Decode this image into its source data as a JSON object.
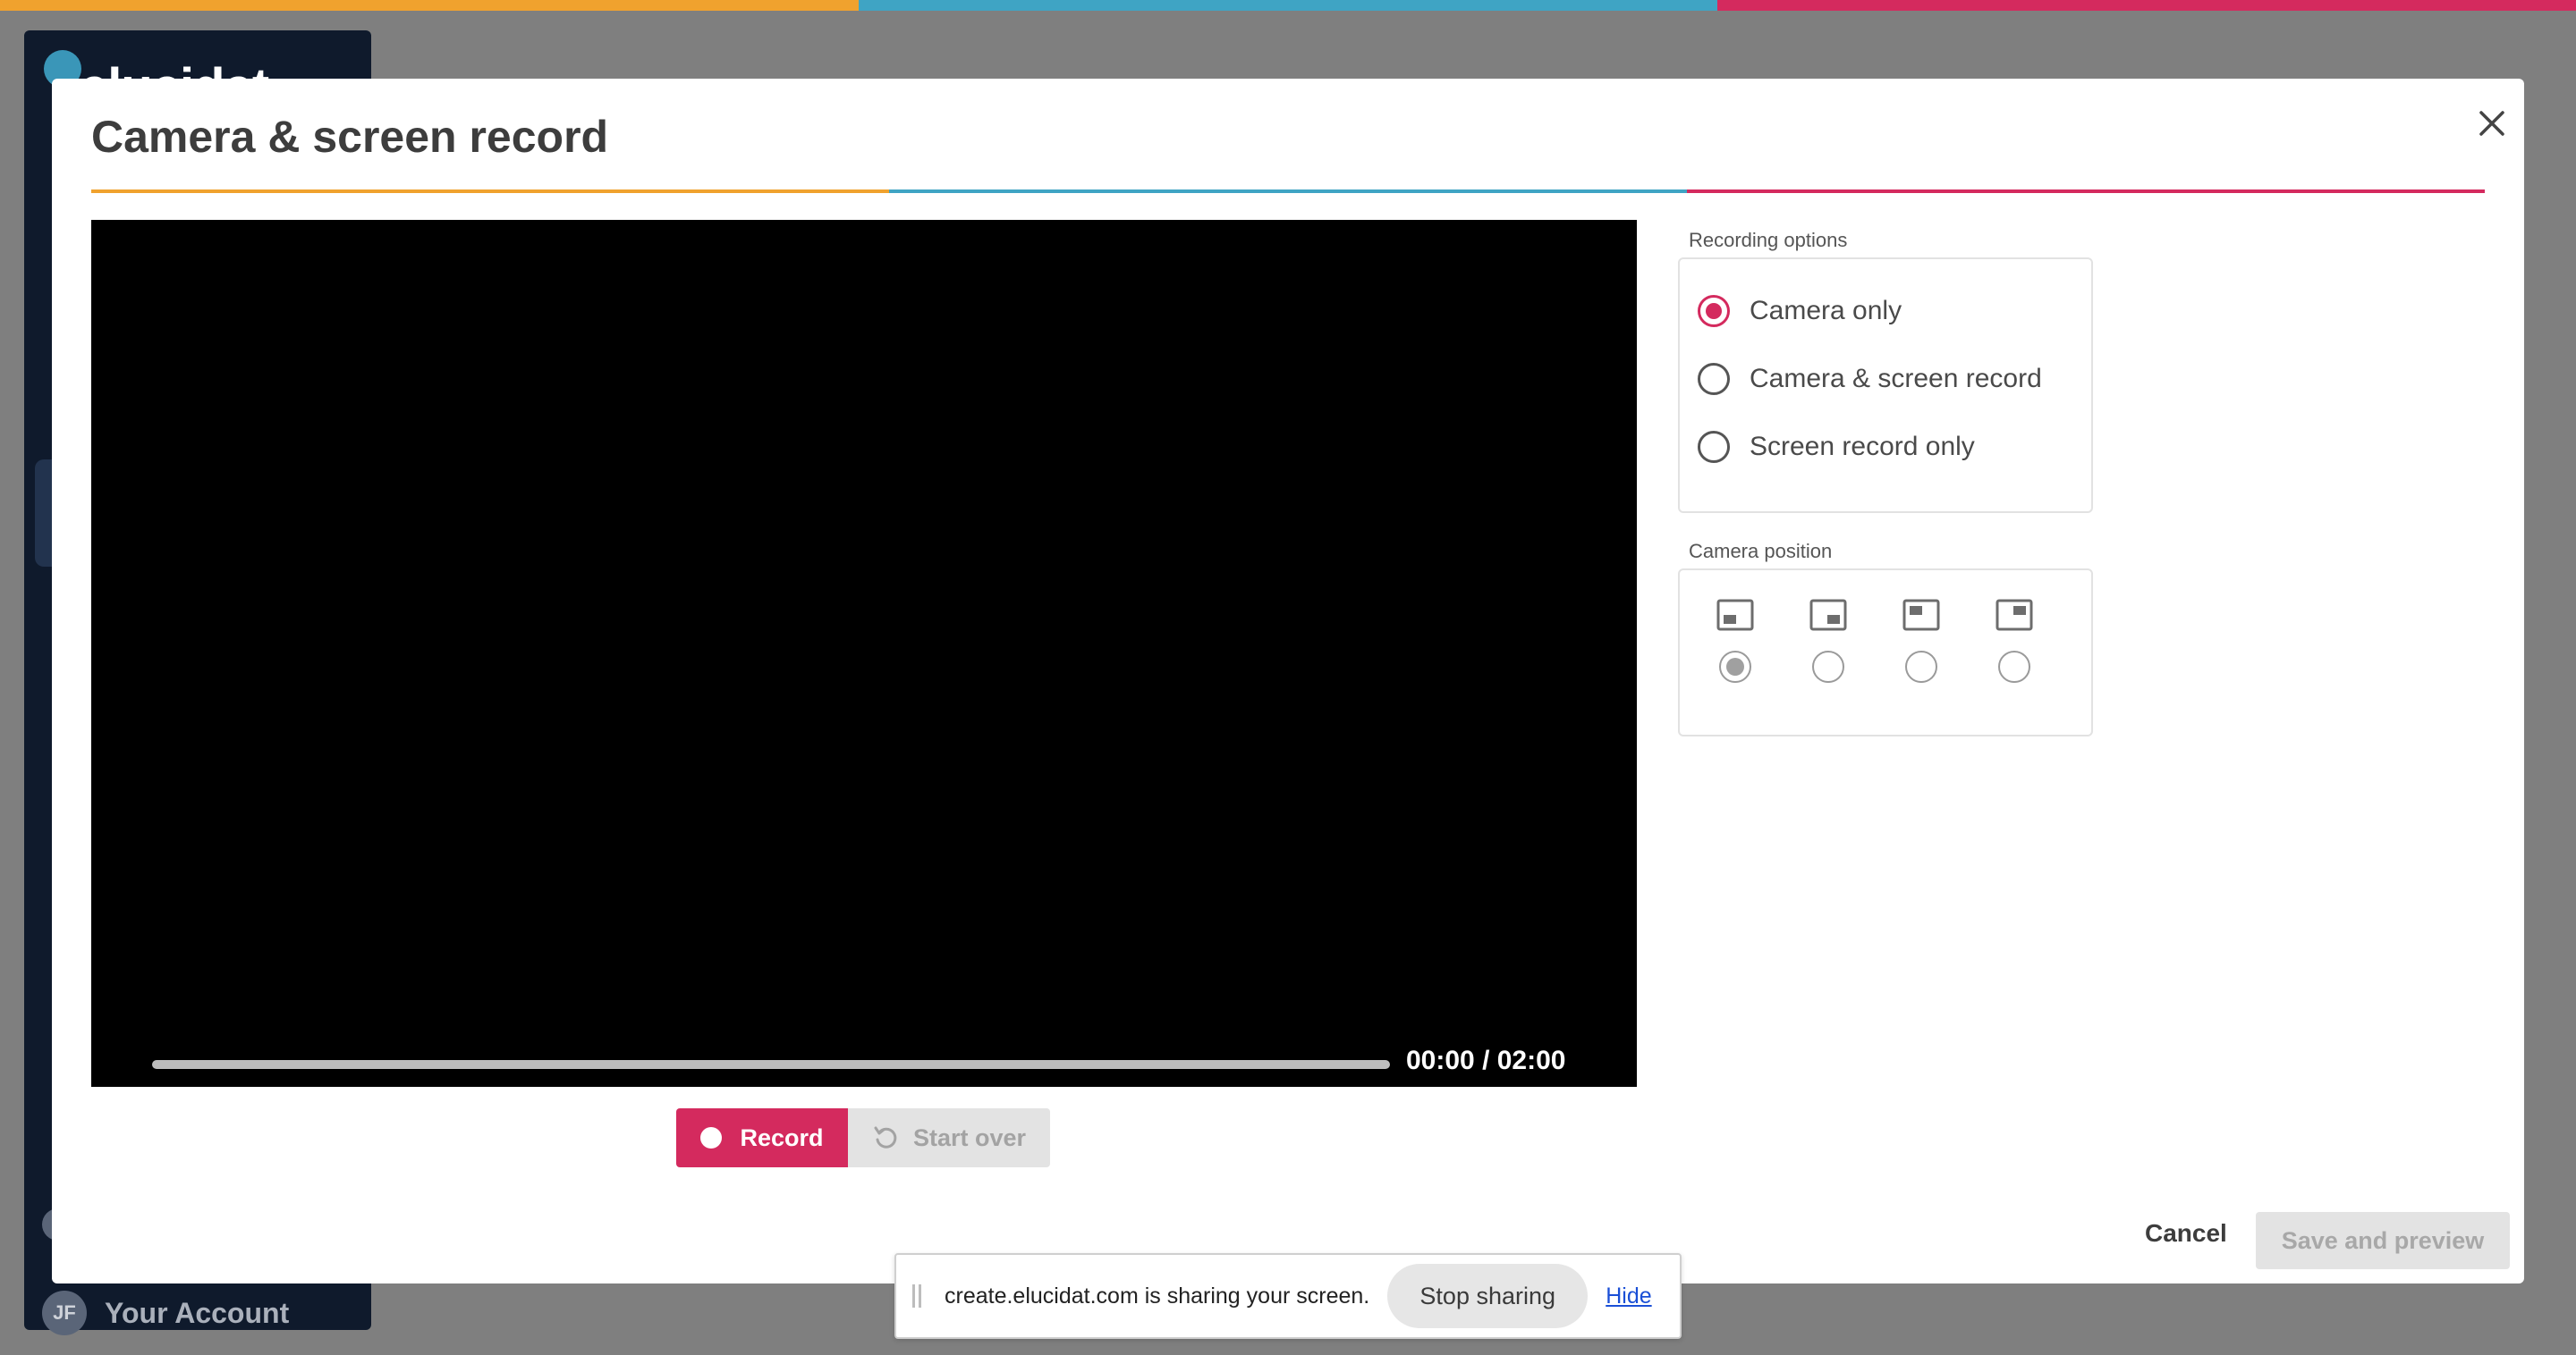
{
  "colors": {
    "accent": "#d42a5e",
    "stripe_orange": "#f0a22e",
    "stripe_blue": "#3fa4c4",
    "stripe_pink": "#d42a5e",
    "sidebar": "#0f1a2c"
  },
  "background_app": {
    "logo_text": "elucidat",
    "account_initials": "JF",
    "account_label": "Your Account"
  },
  "modal": {
    "title": "Camera & screen record",
    "close_icon": "close-icon"
  },
  "video": {
    "time_display": "00:00 / 02:00",
    "progress": 0,
    "record_label": "Record",
    "start_over_label": "Start over"
  },
  "recording_options": {
    "label": "Recording options",
    "options": [
      {
        "label": "Camera only",
        "selected": true
      },
      {
        "label": "Camera & screen record",
        "selected": false
      },
      {
        "label": "Screen record only",
        "selected": false
      }
    ]
  },
  "camera_position": {
    "label": "Camera position",
    "positions": [
      {
        "icon": "position-bottom-left-icon",
        "selected": true
      },
      {
        "icon": "position-bottom-right-icon",
        "selected": false
      },
      {
        "icon": "position-top-left-icon",
        "selected": false
      },
      {
        "icon": "position-top-right-icon",
        "selected": false
      }
    ]
  },
  "footer": {
    "cancel_label": "Cancel",
    "save_label": "Save and preview"
  },
  "sharing_bar": {
    "message": "create.elucidat.com is sharing your screen.",
    "stop_label": "Stop sharing",
    "hide_label": "Hide"
  }
}
